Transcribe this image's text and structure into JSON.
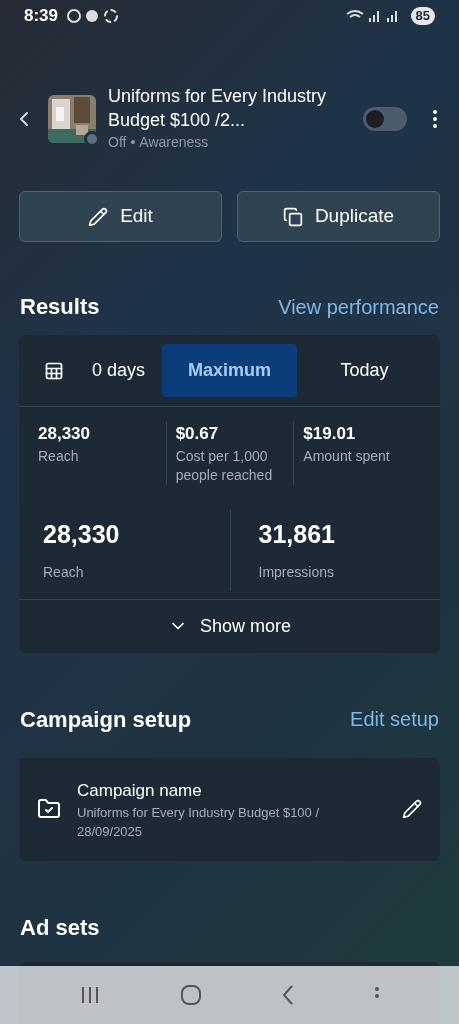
{
  "status_bar": {
    "time": "8:39",
    "battery": "85"
  },
  "header": {
    "title": "Uniforms for Every Industry Budget $100 /2...",
    "status": "Off",
    "separator": "•",
    "objective": "Awareness",
    "on": false
  },
  "actions": [
    {
      "kind": "edit",
      "label": "Edit"
    },
    {
      "kind": "duplicate",
      "label": "Duplicate"
    }
  ],
  "results": {
    "title": "Results",
    "link": "View performance",
    "tabs": [
      {
        "label": "0 days",
        "kind": "calendar",
        "selected": false
      },
      {
        "label": "Maximum",
        "kind": "plain",
        "selected": true
      },
      {
        "label": "Today",
        "kind": "plain",
        "selected": false
      }
    ],
    "metrics": [
      {
        "value": "28,330",
        "label": "Reach"
      },
      {
        "value": "$0.67",
        "label": "Cost per 1,000 people reached"
      },
      {
        "value": "$19.01",
        "label": "Amount spent"
      }
    ],
    "big_metrics": [
      {
        "value": "28,330",
        "label": "Reach"
      },
      {
        "value": "31,861",
        "label": "Impressions"
      }
    ],
    "show_more": "Show more"
  },
  "campaign_setup": {
    "title": "Campaign setup",
    "link": "Edit setup",
    "field_label": "Campaign name",
    "field_value": "Uniforms for Every Industry Budget $100 / 28/09/2025"
  },
  "ad_sets": {
    "title": "Ad sets"
  }
}
